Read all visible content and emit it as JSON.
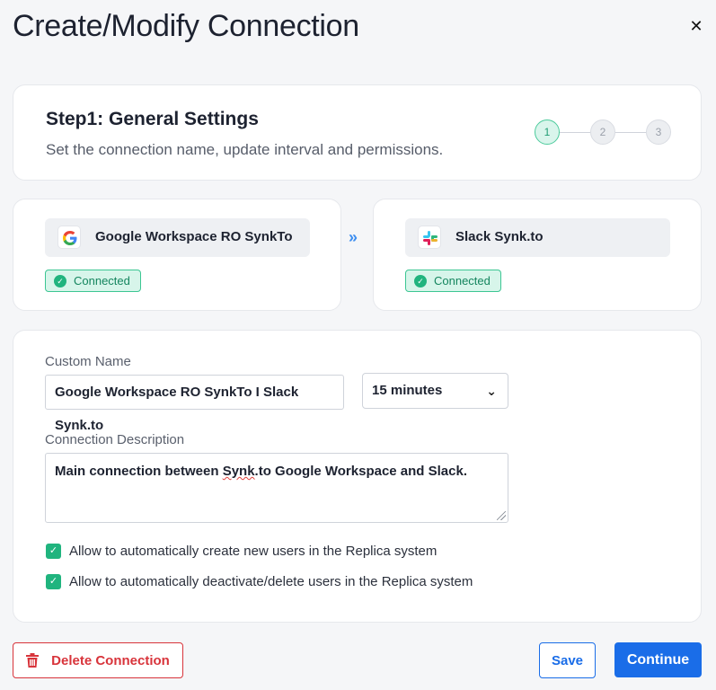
{
  "dialog": {
    "title": "Create/Modify Connection",
    "close_icon": "close-icon"
  },
  "step": {
    "title": "Step1: General Settings",
    "subtitle": "Set the connection name, update interval and permissions.",
    "steps": [
      "1",
      "2",
      "3"
    ],
    "active_step": 1
  },
  "source_system": {
    "name": "Google Workspace RO SynkTo",
    "icon": "google-icon",
    "status": "Connected"
  },
  "target_system": {
    "name": "Slack Synk.to",
    "icon": "slack-icon",
    "status": "Connected"
  },
  "form": {
    "custom_name_label": "Custom Name",
    "custom_name_value": "Google Workspace RO SynkTo I Slack Synk.to",
    "interval_value": "15 minutes",
    "description_label": "Connection Description",
    "description_pre": "Main connection between ",
    "description_misspelled": "Synk",
    "description_post": ".to Google Workspace and Slack.",
    "checkboxes": [
      {
        "label": "Allow to automatically create new users in the Replica system",
        "checked": true
      },
      {
        "label": "Allow to automatically deactivate/delete users in the Replica system",
        "checked": true
      }
    ]
  },
  "footer": {
    "delete_label": "Delete Connection",
    "save_label": "Save",
    "continue_label": "Continue"
  },
  "colors": {
    "accent_blue": "#1a6de8",
    "success_green": "#20b47e",
    "danger_red": "#d8343b"
  }
}
